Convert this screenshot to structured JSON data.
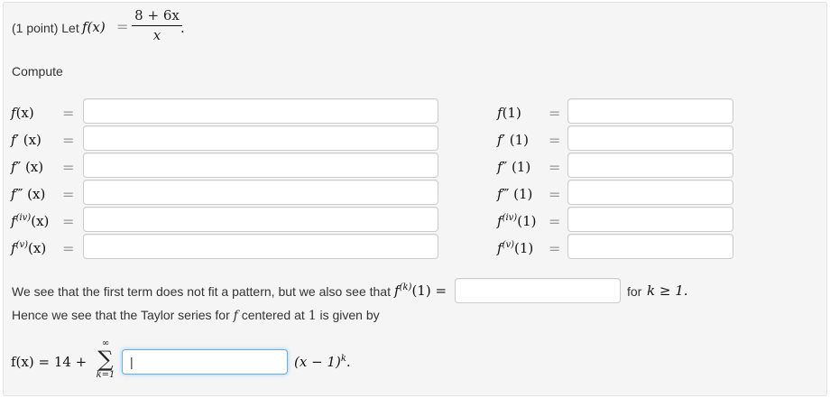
{
  "header": {
    "points_label": "(1 point) Let",
    "func_lhs": "f(x)",
    "eq": "=",
    "numerator": "8 + 6x",
    "denominator": "x",
    "period": "."
  },
  "compute_label": "Compute",
  "eq_sign": "=",
  "left_rows": [
    {
      "base": "f",
      "mark": "",
      "arg": "(x)",
      "value": ""
    },
    {
      "base": "f",
      "mark": "′",
      "arg": "(x)",
      "value": ""
    },
    {
      "base": "f",
      "mark": "″",
      "arg": "(x)",
      "value": ""
    },
    {
      "base": "f",
      "mark": "‴",
      "arg": "(x)",
      "value": ""
    },
    {
      "base": "f",
      "mark": "(iv)",
      "arg": "(x)",
      "value": ""
    },
    {
      "base": "f",
      "mark": "(v)",
      "arg": "(x)",
      "value": ""
    }
  ],
  "right_rows": [
    {
      "base": "f",
      "mark": "",
      "arg": "(1)",
      "value": ""
    },
    {
      "base": "f",
      "mark": "′",
      "arg": "(1)",
      "value": ""
    },
    {
      "base": "f",
      "mark": "″",
      "arg": "(1)",
      "value": ""
    },
    {
      "base": "f",
      "mark": "‴",
      "arg": "(1)",
      "value": ""
    },
    {
      "base": "f",
      "mark": "(iv)",
      "arg": "(1)",
      "value": ""
    },
    {
      "base": "f",
      "mark": "(v)",
      "arg": "(1)",
      "value": ""
    }
  ],
  "pattern": {
    "text": "We see that the first term does not fit a pattern, but we also see that",
    "func": "f",
    "sup": "(k)",
    "arg": "(1) =",
    "value": "",
    "suffix_for": "for",
    "suffix_cond": "k ≥ 1."
  },
  "hence_text": {
    "pre": "Hence we see that the Taylor series for",
    "func": "f",
    "mid": "centered at",
    "center": "1",
    "post": "is given by"
  },
  "series": {
    "lhs": "f(x) = 14 +",
    "sum_top": "∞",
    "sum_symbol": "∑",
    "sum_bottom": "k=1",
    "value": "|",
    "rhs": "(x − 1)",
    "rhs_sup": "k",
    "period": "."
  }
}
